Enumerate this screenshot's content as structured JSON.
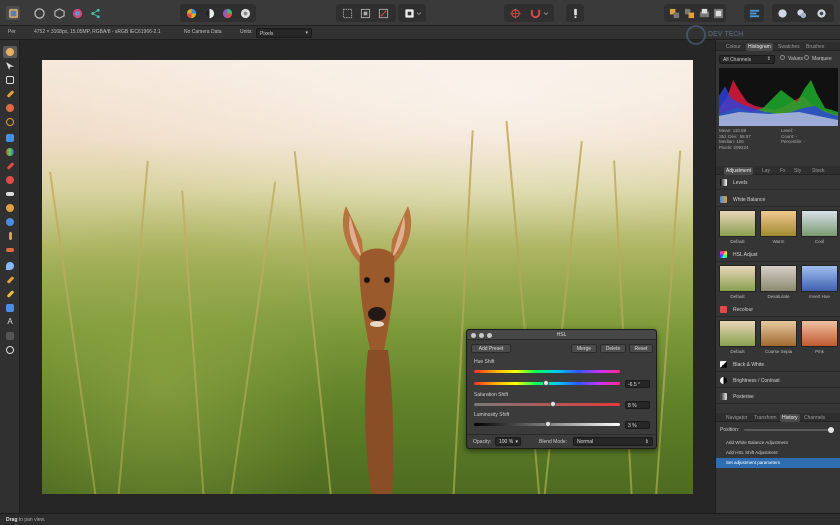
{
  "toolbar": {
    "persona_label": "Per",
    "icons": [
      "circle-icon",
      "cube-icon",
      "color-wheel-icon",
      "share-icon"
    ]
  },
  "context": {
    "doc_info": "4752 × 3168px, 15.05MP, RGBA/8 - sRGB IEC61966-2.1",
    "camera": "No Camera Data",
    "units_label": "Units:",
    "units_value": "Pixels"
  },
  "watermark": "DEV TECH",
  "histogram_panel": {
    "tabs": [
      "Colour",
      "Histogram",
      "Swatches",
      "Brushes"
    ],
    "active_tab": "Histogram",
    "channel": "All Channels",
    "toggles": [
      "Values",
      "Marquee"
    ],
    "stats_left": [
      "Mean: 110.59",
      "Std. Dev.: 58.97",
      "Median: 106",
      "Pixels: 209224"
    ],
    "stats_right": [
      "Level: -",
      "Count: -",
      "Percentile: -"
    ]
  },
  "adjustment_panel": {
    "tabs": [
      "Adjustment",
      "Lay",
      "Fx",
      "Sty",
      "Stock"
    ],
    "items": [
      {
        "label": "Levels"
      },
      {
        "label": "White Balance",
        "presets": [
          "Default",
          "Warm",
          "Cool"
        ]
      },
      {
        "label": "HSL Adjust",
        "presets": [
          "Default",
          "Desaturate",
          "Invert Hue"
        ]
      },
      {
        "label": "Recolour",
        "presets": [
          "Default",
          "Coarse Sepia",
          "Pink"
        ]
      },
      {
        "label": "Black & White"
      },
      {
        "label": "Brightness / Contrast"
      },
      {
        "label": "Posterise"
      }
    ]
  },
  "history_panel": {
    "tabs": [
      "Navigator",
      "Transform",
      "History",
      "Channels"
    ],
    "active_tab": "History",
    "position_label": "Position:",
    "entries": [
      "Add White Balance Adjustment",
      "Add HSL Shift Adjustment",
      "Set adjustment parameters"
    ],
    "selected_index": 2
  },
  "hsl_dialog": {
    "title": "HSL",
    "add_preset": "Add Preset",
    "merge": "Merge",
    "delete": "Delete",
    "reset": "Reset",
    "hue_label": "Hue Shift",
    "hue_value": "-6.5 °",
    "hue_level": 0.49,
    "saturation_label": "Saturation Shift",
    "saturation_value": "8 %",
    "saturation_level": 0.54,
    "luminosity_label": "Luminosity Shift",
    "luminosity_value": "3 %",
    "luminosity_level": 0.51,
    "opacity_label": "Opacity:",
    "opacity_value": "100 %",
    "blend_label": "Blend Mode:",
    "blend_value": "Normal"
  },
  "status": {
    "action": "Drag",
    "hint": "to pan view."
  },
  "colors": {
    "accent": "#2f6db0",
    "panel": "#353535",
    "canvas": "#262626"
  }
}
